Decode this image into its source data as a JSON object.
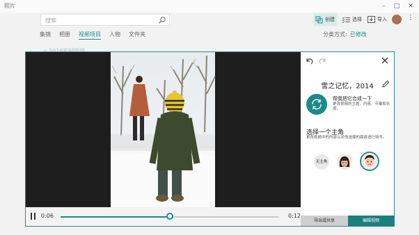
{
  "app": {
    "title": "照片"
  },
  "window": {
    "minimize": "–",
    "maximize": "□",
    "close": "✕"
  },
  "search": {
    "placeholder": "搜索"
  },
  "toolbar": {
    "create": "创建",
    "select": "选择",
    "import": "导入",
    "more": "⋮"
  },
  "tabs": [
    {
      "label": "集锦",
      "active": false
    },
    {
      "label": "相册",
      "active": false
    },
    {
      "label": "视频项目",
      "active": true
    },
    {
      "label": "人物",
      "active": false
    },
    {
      "label": "文件夹",
      "active": false
    }
  ],
  "sort": {
    "label": "分类方式:",
    "value": "已修改"
  },
  "ghost_text": "▫ 2018视频项目",
  "player": {
    "current_time": "0:06",
    "total_time": "0:12",
    "progress": 0.5
  },
  "panel": {
    "video_title": "雪之记忆，2014",
    "remix_title": "帮我把它合成一下",
    "remix_desc": "更改视频的主题、内容、节奏和长度。",
    "character_title": "选择一个主角",
    "character_desc": "更改视频中的内容以对你选择的面容进行特写。",
    "no_character": "无主角",
    "export_label": "导出或共享",
    "edit_label": "编辑视频"
  },
  "colors": {
    "accent": "#1a8a8a",
    "accent_dark": "#1a7f7f",
    "frame": "#2a8c8c"
  },
  "icons": [
    "search-icon",
    "create-icon",
    "select-icon",
    "import-icon",
    "undo-icon",
    "redo-icon",
    "close-icon",
    "edit-pencil-icon",
    "remix-icon",
    "pause-icon"
  ]
}
